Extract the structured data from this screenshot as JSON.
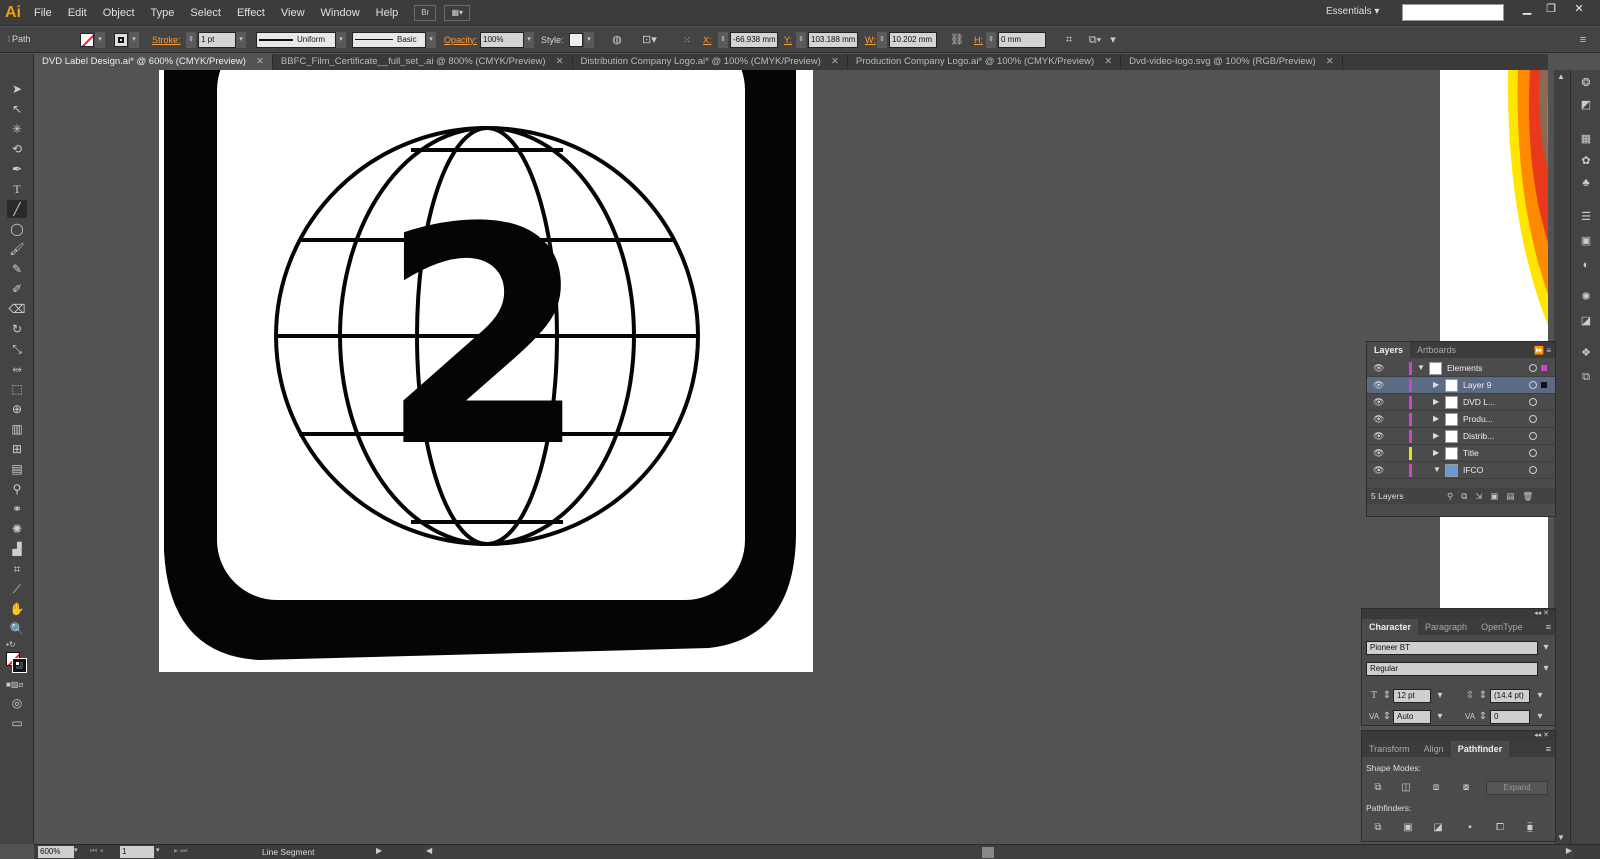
{
  "app": {
    "logo": "Ai"
  },
  "menu": [
    "File",
    "Edit",
    "Object",
    "Type",
    "Select",
    "Effect",
    "View",
    "Window",
    "Help"
  ],
  "menubar": {
    "bridge_button": "Br",
    "workspace_label": "Essentials",
    "search_placeholder": ""
  },
  "controlbar": {
    "selection_type": "Path",
    "stroke_label": "Stroke:",
    "stroke_weight": "1 pt",
    "stroke_profile": "Uniform",
    "brush": "Basic",
    "opacity_label": "Opacity:",
    "opacity_value": "100%",
    "style_label": "Style:",
    "x_label": "X:",
    "x_value": "-66.938 mm",
    "y_label": "Y:",
    "y_value": "103.188 mm",
    "w_label": "W:",
    "w_value": "10.202 mm",
    "h_label": "H:",
    "h_value": "0 mm"
  },
  "tabs": [
    {
      "label": "DVD Label Design.ai* @ 600% (CMYK/Preview)",
      "active": true
    },
    {
      "label": "BBFC_Film_Certificate__full_set_.ai @ 800% (CMYK/Preview)",
      "active": false
    },
    {
      "label": "Distribution Company Logo.ai* @ 100% (CMYK/Preview)",
      "active": false
    },
    {
      "label": "Production Company Logo.ai* @ 100% (CMYK/Preview)",
      "active": false
    },
    {
      "label": "Dvd-video-logo.svg @ 100% (RGB/Preview)",
      "active": false
    }
  ],
  "artwork": {
    "numeral": "2"
  },
  "layers_panel": {
    "tabs": [
      "Layers",
      "Artboards"
    ],
    "rows": [
      {
        "name": "Elements",
        "color": "#cc44cc",
        "expanded": true,
        "indent": 0
      },
      {
        "name": "Layer 9",
        "color": "#cc44cc",
        "expanded": false,
        "indent": 1,
        "selected": true
      },
      {
        "name": "DVD L...",
        "color": "#cc44cc",
        "expanded": false,
        "indent": 1
      },
      {
        "name": "Produ...",
        "color": "#cc44cc",
        "expanded": false,
        "indent": 1
      },
      {
        "name": "Distrib...",
        "color": "#cc44cc",
        "expanded": false,
        "indent": 1
      },
      {
        "name": "Title",
        "color": "#e8e020",
        "expanded": false,
        "indent": 1
      },
      {
        "name": "IFCO",
        "color": "#cc44cc",
        "expanded": true,
        "indent": 1
      }
    ],
    "footer": "5 Layers"
  },
  "character_panel": {
    "tabs": [
      "Character",
      "Paragraph",
      "OpenType"
    ],
    "font_family": "Pioneer BT",
    "font_style": "Regular",
    "font_size": "12 pt",
    "leading": "(14.4 pt)",
    "kerning": "Auto",
    "tracking": "0"
  },
  "pathfinder_panel": {
    "tabs": [
      "Transform",
      "Align",
      "Pathfinder"
    ],
    "shape_modes_label": "Shape Modes:",
    "expand_label": "Expand",
    "pathfinders_label": "Pathfinders:"
  },
  "statusbar": {
    "zoom": "600%",
    "artboard": "1",
    "tool_name": "Line Segment"
  }
}
